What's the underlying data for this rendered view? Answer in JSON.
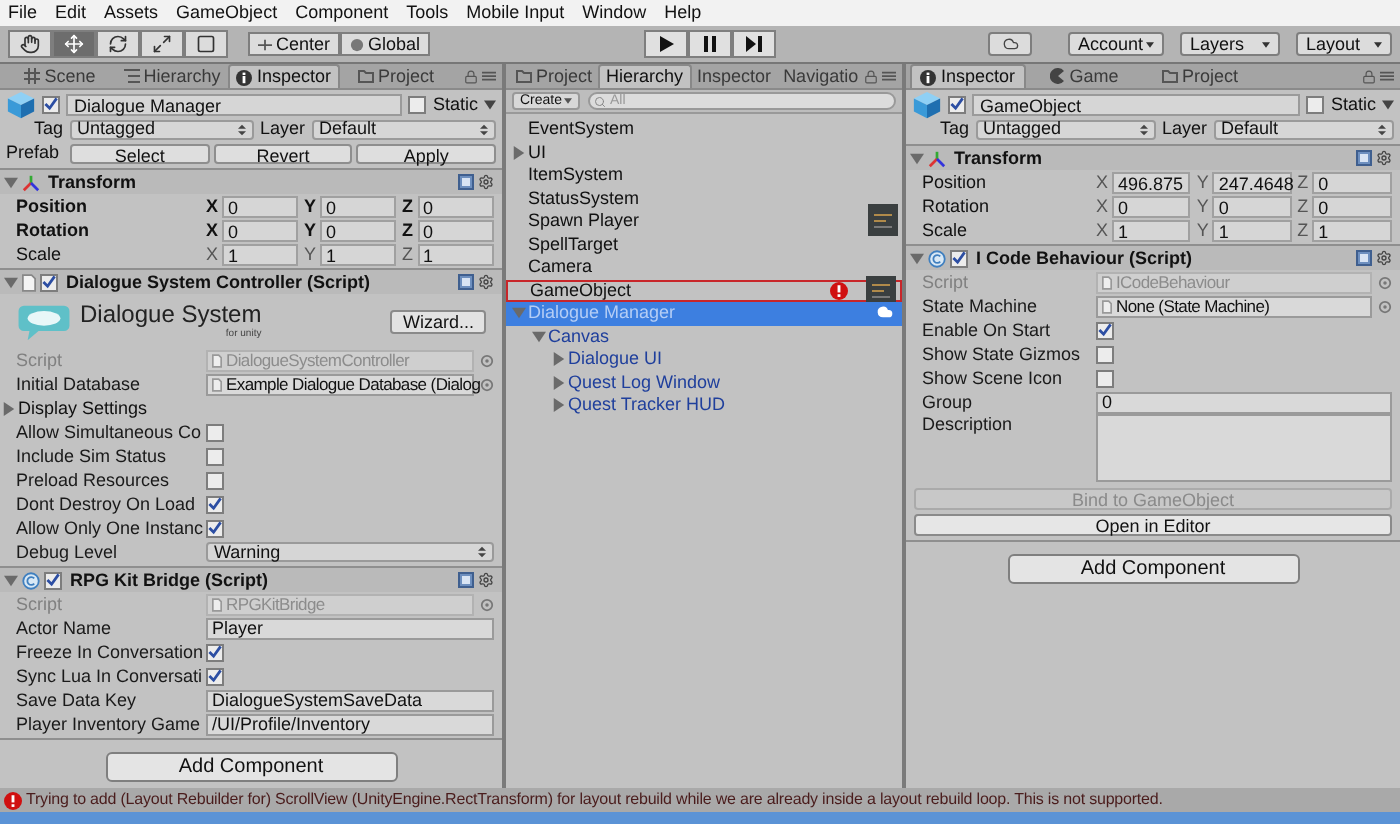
{
  "menu_bar": [
    "File",
    "Edit",
    "Assets",
    "GameObject",
    "Component",
    "Tools",
    "Mobile Input",
    "Window",
    "Help"
  ],
  "toolbar": {
    "tools": [
      {
        "kind": "hand",
        "selected": false
      },
      {
        "kind": "move",
        "selected": true
      },
      {
        "kind": "rotate",
        "selected": false
      },
      {
        "kind": "scale",
        "selected": false
      },
      {
        "kind": "rect",
        "selected": false
      }
    ],
    "pivot_buttons": [
      {
        "kind": "pivot",
        "label": "Center"
      },
      {
        "kind": "global",
        "label": "Global"
      }
    ],
    "account": "Account",
    "layers": "Layers",
    "layout": "Layout"
  },
  "left_inspector": {
    "tabs": [
      {
        "kind": "scene",
        "label": "Scene",
        "selected": false
      },
      {
        "kind": "hierarchy",
        "label": "Hierarchy",
        "selected": false
      },
      {
        "kind": "inspector",
        "label": "Inspector",
        "selected": true
      },
      {
        "kind": "project",
        "label": "Project",
        "selected": false
      }
    ],
    "object": {
      "active": true,
      "name": "Dialogue Manager",
      "static_label": "Static",
      "static": false,
      "tag_label": "Tag",
      "tag": "Untagged",
      "layer_label": "Layer",
      "layer": "Default"
    },
    "prefab": {
      "label": "Prefab",
      "buttons": [
        "Select",
        "Revert",
        "Apply"
      ]
    },
    "components": [
      {
        "kind": "transform",
        "title": "Transform",
        "expanded": true,
        "fields": [
          {
            "kind": "vector3",
            "label": "Position",
            "bold": true,
            "values": [
              {
                "axis": "X",
                "value": "0"
              },
              {
                "axis": "Y",
                "value": "0"
              },
              {
                "axis": "Z",
                "value": "0"
              }
            ]
          },
          {
            "kind": "vector3",
            "label": "Rotation",
            "bold": true,
            "values": [
              {
                "axis": "X",
                "value": "0"
              },
              {
                "axis": "Y",
                "value": "0"
              },
              {
                "axis": "Z",
                "value": "0"
              }
            ]
          },
          {
            "kind": "vector3",
            "label": "Scale",
            "bold": false,
            "values": [
              {
                "axis": "X",
                "value": "1"
              },
              {
                "axis": "Y",
                "value": "1"
              },
              {
                "axis": "Z",
                "value": "1"
              }
            ]
          }
        ]
      },
      {
        "kind": "script",
        "title": "Dialogue System Controller (Script)",
        "expanded": true,
        "enabled": true,
        "fields": [
          {
            "kind": "logo",
            "title": "Dialogue System",
            "subtitle": "for unity",
            "button": "Wizard..."
          },
          {
            "kind": "object",
            "label": "Script",
            "value": "DialogueSystemController",
            "disabled": true
          },
          {
            "kind": "object",
            "label": "Initial Database",
            "value": "Example Dialogue Database (Dialog",
            "disabled": false
          },
          {
            "kind": "foldout",
            "label": "Display Settings",
            "expanded": false
          },
          {
            "kind": "checkbox",
            "label": "Allow Simultaneous Co",
            "checked": false
          },
          {
            "kind": "checkbox",
            "label": "Include Sim Status",
            "checked": false
          },
          {
            "kind": "checkbox",
            "label": "Preload Resources",
            "checked": false
          },
          {
            "kind": "checkbox",
            "label": "Dont Destroy On Load",
            "checked": true
          },
          {
            "kind": "checkbox",
            "label": "Allow Only One Instanc",
            "checked": true
          },
          {
            "kind": "dropdown",
            "label": "Debug Level",
            "value": "Warning"
          }
        ]
      },
      {
        "kind": "behaviour",
        "title": "RPG Kit Bridge (Script)",
        "expanded": true,
        "enabled": true,
        "fields": [
          {
            "kind": "object",
            "label": "Script",
            "value": "RPGKitBridge",
            "disabled": true
          },
          {
            "kind": "text",
            "label": "Actor Name",
            "value": "Player"
          },
          {
            "kind": "checkbox",
            "label": "Freeze In Conversation",
            "checked": true
          },
          {
            "kind": "checkbox",
            "label": "Sync Lua In Conversati",
            "checked": true
          },
          {
            "kind": "text",
            "label": "Save Data Key",
            "value": "DialogueSystemSaveData"
          },
          {
            "kind": "text",
            "label": "Player Inventory Game",
            "value": "/UI/Profile/Inventory"
          }
        ]
      }
    ],
    "add_component": "Add Component"
  },
  "hierarchy": {
    "tabs": [
      {
        "kind": "project",
        "label": "Project",
        "selected": false
      },
      {
        "kind": "hierarchy",
        "label": "Hierarchy",
        "selected": true
      },
      {
        "kind": "inspector",
        "label": "Inspector",
        "selected": false
      },
      {
        "kind": "navigation",
        "label": "Navigatio",
        "selected": false
      }
    ],
    "create": "Create",
    "search_placeholder": "All",
    "items": [
      {
        "label": "EventSystem",
        "selected": false,
        "prefab": false,
        "error": false,
        "thumbnail": false,
        "cloud_icon": false
      },
      {
        "label": "UI",
        "selected": false,
        "prefab": false,
        "error": false,
        "thumbnail": false,
        "cloud_icon": false,
        "expanded": false
      },
      {
        "label": "ItemSystem",
        "selected": false,
        "prefab": false,
        "error": false,
        "thumbnail": false,
        "cloud_icon": false
      },
      {
        "label": "StatusSystem",
        "selected": false,
        "prefab": false,
        "error": false,
        "thumbnail": false,
        "cloud_icon": false
      },
      {
        "label": "Spawn Player",
        "selected": false,
        "prefab": false,
        "error": false,
        "thumbnail": true,
        "cloud_icon": false
      },
      {
        "label": "SpellTarget",
        "selected": false,
        "prefab": false,
        "error": false,
        "thumbnail": false,
        "cloud_icon": false
      },
      {
        "label": "Camera",
        "selected": false,
        "prefab": false,
        "error": false,
        "thumbnail": false,
        "cloud_icon": false
      },
      {
        "label": "GameObject",
        "selected": false,
        "prefab": false,
        "error": true,
        "thumbnail": true,
        "cloud_icon": false
      },
      {
        "label": "Dialogue Manager",
        "selected": true,
        "prefab": true,
        "error": false,
        "thumbnail": false,
        "cloud_icon": true,
        "expanded": true,
        "children": [
          {
            "label": "Canvas",
            "selected": false,
            "prefab": true,
            "expanded": true,
            "children": [
              {
                "label": "Dialogue UI",
                "selected": false,
                "prefab": true,
                "expanded": false
              },
              {
                "label": "Quest Log Window",
                "selected": false,
                "prefab": true,
                "expanded": false
              },
              {
                "label": "Quest Tracker HUD",
                "selected": false,
                "prefab": true,
                "expanded": false
              }
            ]
          }
        ]
      }
    ]
  },
  "right_inspector": {
    "tabs": [
      {
        "kind": "inspector",
        "label": "Inspector",
        "selected": true
      },
      {
        "kind": "game",
        "label": "Game",
        "selected": false
      },
      {
        "kind": "project",
        "label": "Project",
        "selected": false
      }
    ],
    "object": {
      "active": true,
      "name": "GameObject",
      "static_label": "Static",
      "static": false,
      "tag_label": "Tag",
      "tag": "Untagged",
      "layer_label": "Layer",
      "layer": "Default"
    },
    "components": [
      {
        "kind": "transform",
        "title": "Transform",
        "expanded": true,
        "fields": [
          {
            "kind": "vector3",
            "label": "Position",
            "bold": false,
            "values": [
              {
                "axis": "X",
                "value": "496.875"
              },
              {
                "axis": "Y",
                "value": "247.4648"
              },
              {
                "axis": "Z",
                "value": "0"
              }
            ]
          },
          {
            "kind": "vector3",
            "label": "Rotation",
            "bold": false,
            "values": [
              {
                "axis": "X",
                "value": "0"
              },
              {
                "axis": "Y",
                "value": "0"
              },
              {
                "axis": "Z",
                "value": "0"
              }
            ]
          },
          {
            "kind": "vector3",
            "label": "Scale",
            "bold": false,
            "values": [
              {
                "axis": "X",
                "value": "1"
              },
              {
                "axis": "Y",
                "value": "1"
              },
              {
                "axis": "Z",
                "value": "1"
              }
            ]
          }
        ]
      },
      {
        "kind": "behaviour",
        "title": "I Code Behaviour (Script)",
        "expanded": true,
        "enabled": true,
        "fields": [
          {
            "kind": "object",
            "label": "Script",
            "value": "ICodeBehaviour",
            "disabled": true
          },
          {
            "kind": "object",
            "label": "State Machine",
            "value": "None (State Machine)",
            "disabled": false
          },
          {
            "kind": "checkbox",
            "label": "Enable On Start",
            "checked": true
          },
          {
            "kind": "checkbox",
            "label": "Show State Gizmos",
            "checked": false
          },
          {
            "kind": "checkbox",
            "label": "Show Scene Icon",
            "checked": false
          },
          {
            "kind": "text",
            "label": "Group",
            "value": "0"
          },
          {
            "kind": "textarea",
            "label": "Description"
          },
          {
            "kind": "button",
            "label": "Bind to GameObject",
            "disabled": true
          },
          {
            "kind": "button",
            "label": "Open in Editor",
            "disabled": false
          }
        ]
      }
    ],
    "add_component": "Add Component"
  },
  "status_bar": {
    "message": "Trying to add (Layout Rebuilder for) ScrollView (UnityEngine.RectTransform) for layout rebuild while we are already inside a layout rebuild loop. This is not supported."
  }
}
